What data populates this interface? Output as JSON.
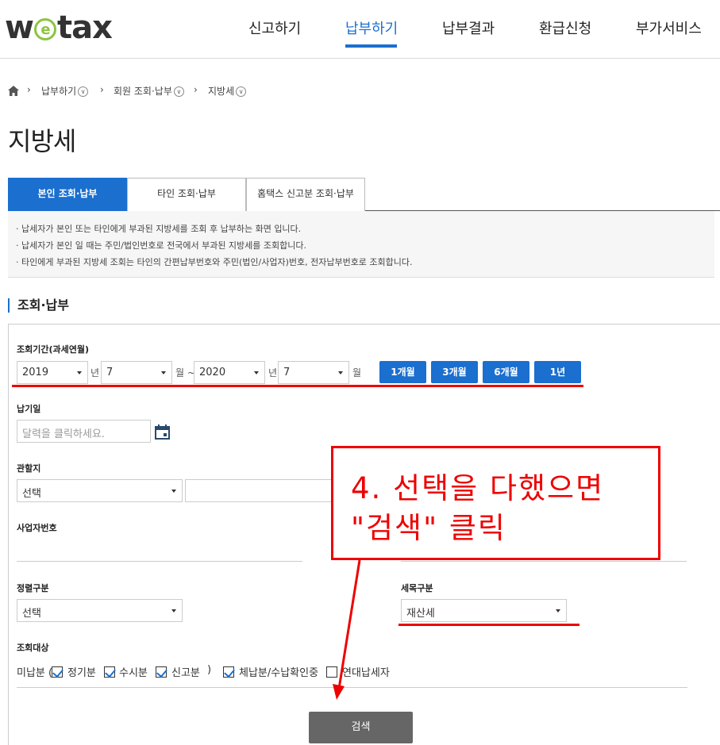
{
  "header": {
    "logo": {
      "pre": "w",
      "mid": "e",
      "post": "tax"
    },
    "nav": [
      {
        "label": "신고하기",
        "active": false
      },
      {
        "label": "납부하기",
        "active": true
      },
      {
        "label": "납부결과",
        "active": false
      },
      {
        "label": "환급신청",
        "active": false
      },
      {
        "label": "부가서비스",
        "active": false
      }
    ]
  },
  "breadcrumb": {
    "items": [
      "납부하기",
      "회원 조회·납부",
      "지방세"
    ]
  },
  "page_title": "지방세",
  "tabs": [
    {
      "label": "본인 조회·납부",
      "active": true
    },
    {
      "label": "타인 조회·납부",
      "active": false
    },
    {
      "label": "홈택스 신고분 조회·납부",
      "active": false
    }
  ],
  "info": [
    "· 납세자가 본인 또는 타인에게 부과된 지방세를 조회 후 납부하는 화면 입니다.",
    "· 납세자가 본인 일 때는 주민/법인번호로 전국에서 부과된 지방세를 조회합니다.",
    "· 타인에게 부과된 지방세 조회는 타인의 간편납부번호와 주민(법인/사업자)번호, 전자납부번호로 조회합니다."
  ],
  "section_title": "조회·납부",
  "form": {
    "period": {
      "label": "조회기간(과세연월)",
      "from_year": "2019",
      "year_unit": "년",
      "from_month": "7",
      "month_unit_tilde": "월 ~",
      "to_year": "2020",
      "to_month": "7",
      "month_unit": "월",
      "buttons": [
        "1개월",
        "3개월",
        "6개월",
        "1년"
      ]
    },
    "due_date": {
      "label": "납기일",
      "placeholder": "달력을 클릭하세요."
    },
    "jurisdiction": {
      "label": "관할지",
      "value": "선택"
    },
    "business_no": {
      "label": "사업자번호"
    },
    "sort": {
      "label": "정렬구분",
      "value": "선택"
    },
    "tax_item": {
      "label": "세목구분",
      "value": "재산세"
    },
    "target": {
      "label": "조회대상",
      "unpaid_prefix": "미납분 (",
      "checks": [
        {
          "label": "정기분",
          "checked": true
        },
        {
          "label": "수시분",
          "checked": true
        },
        {
          "label": "신고분",
          "checked": true
        }
      ],
      "close_paren": ")",
      "delinquent": {
        "label": "체납분/수납확인중",
        "checked": true
      },
      "joint": {
        "label": "연대납세자",
        "checked": false
      }
    },
    "search_button": "검색"
  },
  "annotation": {
    "line1": "4. 선택을 다했으면",
    "line2": "\"검색\" 클릭"
  },
  "colors": {
    "brand_blue": "#1a6fcf",
    "logo_green": "#8bc53f",
    "annotation_red": "#ee0000",
    "search_gray": "#666666"
  }
}
